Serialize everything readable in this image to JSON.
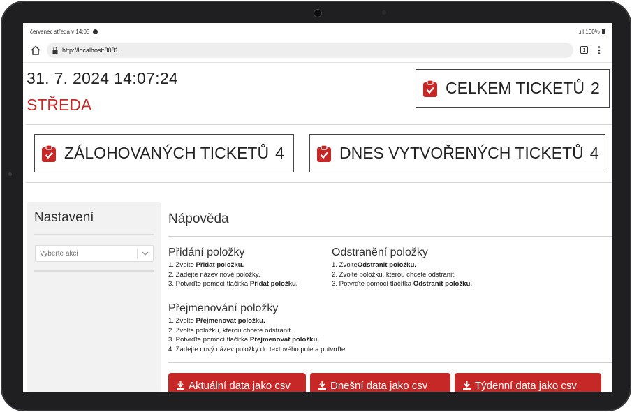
{
  "statusbar": {
    "left_text": "červenec středa v 14:03",
    "right_text": ".ıll 100%"
  },
  "browser": {
    "url": "http://localhost:8081",
    "tab_count": "1"
  },
  "header": {
    "datetime": "31. 7. 2024 14:07:24",
    "weekday": "STŘEDA"
  },
  "stats": {
    "total_label": "CELKEM TICKETŮ",
    "total_value": "2",
    "backup_label": "ZÁLOHOVANÝCH TICKETŮ",
    "backup_value": "4",
    "today_label": "DNES VYTVOŘENÝCH TICKETŮ",
    "today_value": "4"
  },
  "sidebar": {
    "title": "Nastavení",
    "select_placeholder": "Vyberte akci"
  },
  "help": {
    "title": "Nápověda",
    "add": {
      "title": "Přidání položky",
      "l1_pre": "1. Zvolte ",
      "l1_bold": "Přidat položku.",
      "l2": "2. Zadejte název nové položky.",
      "l3_pre": "3. Potvrďte pomocí tlačítka ",
      "l3_bold": "Přidat položku."
    },
    "remove": {
      "title": "Odstranění položky",
      "l1_pre": "1. Zvolte",
      "l1_bold": "Odstranit položku.",
      "l2": "2. Zvolte položku, kterou chcete odstranit.",
      "l3_pre": "3. Potvrďte pomocí tlačítka ",
      "l3_bold": "Odstranit položku."
    },
    "rename": {
      "title": "Přejmenování položky",
      "l1_pre": "1. Zvolte ",
      "l1_bold": "Přejmenovat položku.",
      "l2": "2. Zvolte položku, kterou chcete odstranit.",
      "l3_pre": "3. Potvrďte pomocí tlačítka ",
      "l3_bold": "Přejmenovat položku.",
      "l4": "4. Zadejte nový název položky do textového pole a potvrďte"
    }
  },
  "buttons": {
    "current_csv": "Aktuální data jako csv",
    "today_csv": "Dnešní data jako csv",
    "weekly_csv": "Týdenní data jako csv"
  },
  "colors": {
    "accent": "#c62828"
  }
}
